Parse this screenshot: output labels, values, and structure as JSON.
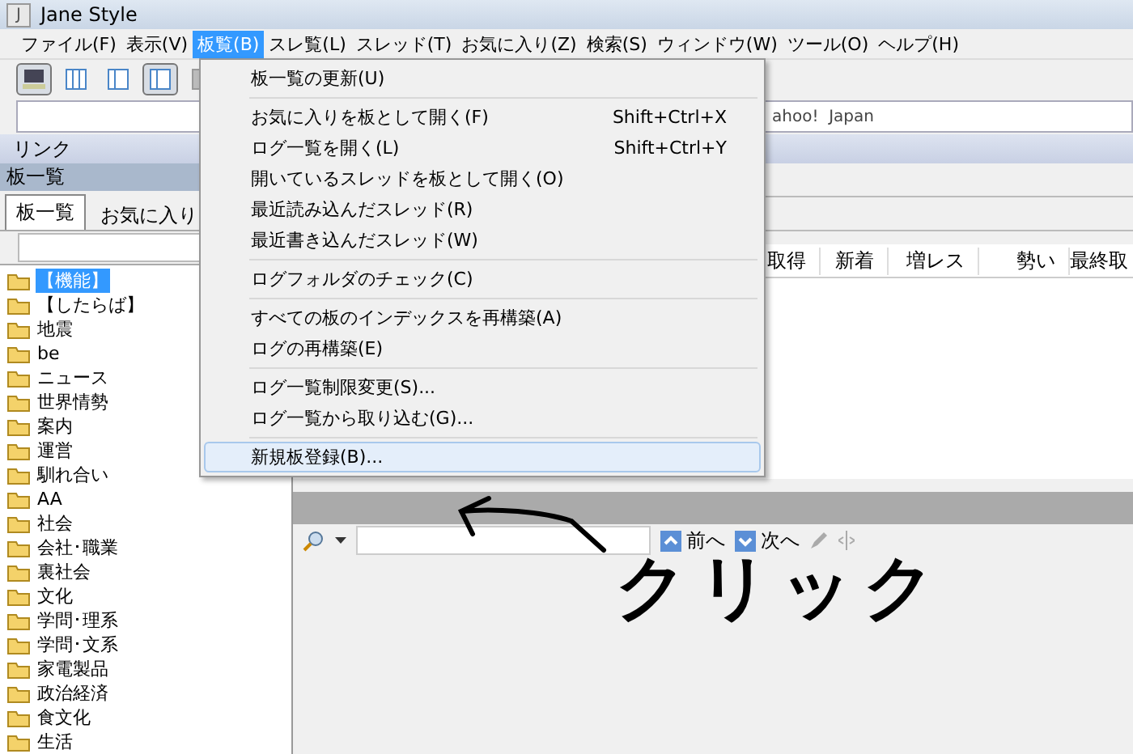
{
  "window": {
    "title": "Jane Style",
    "icon_letter": "J"
  },
  "menu_bar": [
    {
      "label": "ファイル(F)",
      "selected": false
    },
    {
      "label": "表示(V)",
      "selected": false
    },
    {
      "label": "板覧(B)",
      "selected": true
    },
    {
      "label": "スレ覧(L)",
      "selected": false
    },
    {
      "label": "スレッド(T)",
      "selected": false
    },
    {
      "label": "お気に入り(Z)",
      "selected": false
    },
    {
      "label": "検索(S)",
      "selected": false
    },
    {
      "label": "ウィンドウ(W)",
      "selected": false
    },
    {
      "label": "ツール(O)",
      "selected": false
    },
    {
      "label": "ヘルプ(H)",
      "selected": false
    }
  ],
  "toolbar": [
    {
      "kind": "network",
      "pressed": true
    },
    {
      "kind": "columns3",
      "pressed": false
    },
    {
      "kind": "columns2",
      "pressed": false
    },
    {
      "kind": "columns2",
      "pressed": true
    },
    {
      "kind": "half",
      "pressed": false
    }
  ],
  "address_bar": {
    "value": "ahoo!  Japan"
  },
  "link_bar": {
    "label": "リンク"
  },
  "board_pane": {
    "title": "板一覧",
    "tabs": [
      {
        "label": "板一覧",
        "selected": true
      },
      {
        "label": "お気に入り",
        "selected": false
      }
    ],
    "tree": [
      {
        "label": "【機能】",
        "selected": true
      },
      {
        "label": "【したらば】",
        "selected": false
      },
      {
        "label": "地震",
        "selected": false
      },
      {
        "label": "be",
        "selected": false
      },
      {
        "label": "ニュース",
        "selected": false
      },
      {
        "label": "世界情勢",
        "selected": false
      },
      {
        "label": "案内",
        "selected": false
      },
      {
        "label": "運営",
        "selected": false
      },
      {
        "label": "馴れ合い",
        "selected": false
      },
      {
        "label": "AA",
        "selected": false
      },
      {
        "label": "社会",
        "selected": false
      },
      {
        "label": "会社･職業",
        "selected": false
      },
      {
        "label": "裏社会",
        "selected": false
      },
      {
        "label": "文化",
        "selected": false
      },
      {
        "label": "学問･理系",
        "selected": false
      },
      {
        "label": "学問･文系",
        "selected": false
      },
      {
        "label": "家電製品",
        "selected": false
      },
      {
        "label": "政治経済",
        "selected": false
      },
      {
        "label": "食文化",
        "selected": false
      },
      {
        "label": "生活",
        "selected": false
      }
    ]
  },
  "thread_list": {
    "columns": [
      "取得",
      "新着",
      "増レス",
      "勢い",
      "最終取"
    ]
  },
  "thread_view": {
    "buttons": [
      {
        "label": "前へ",
        "kind": "up"
      },
      {
        "label": "次へ",
        "kind": "down"
      }
    ]
  },
  "dropdown_menu": [
    {
      "kind": "item",
      "label": "板一覧の更新(U)",
      "selected": false
    },
    {
      "kind": "separator"
    },
    {
      "kind": "item",
      "label": "お気に入りを板として開く(F)",
      "shortcut": "Shift+Ctrl+X",
      "selected": false
    },
    {
      "kind": "item",
      "label": "ログ一覧を開く(L)",
      "shortcut": "Shift+Ctrl+Y",
      "selected": false
    },
    {
      "kind": "item",
      "label": "開いているスレッドを板として開く(O)",
      "selected": false
    },
    {
      "kind": "item",
      "label": "最近読み込んだスレッド(R)",
      "selected": false
    },
    {
      "kind": "item",
      "label": "最近書き込んだスレッド(W)",
      "selected": false
    },
    {
      "kind": "separator"
    },
    {
      "kind": "item",
      "label": "ログフォルダのチェック(C)",
      "selected": false
    },
    {
      "kind": "separator"
    },
    {
      "kind": "item",
      "label": "すべての板のインデックスを再構築(A)",
      "selected": false
    },
    {
      "kind": "item",
      "label": "ログの再構築(E)",
      "selected": false
    },
    {
      "kind": "separator"
    },
    {
      "kind": "item",
      "label": "ログ一覧制限変更(S)...",
      "selected": false
    },
    {
      "kind": "item",
      "label": "ログ一覧から取り込む(G)...",
      "selected": false
    },
    {
      "kind": "separator"
    },
    {
      "kind": "item",
      "label": "新規板登録(B)...",
      "selected": true
    }
  ],
  "annotation": {
    "text": "クリック"
  }
}
